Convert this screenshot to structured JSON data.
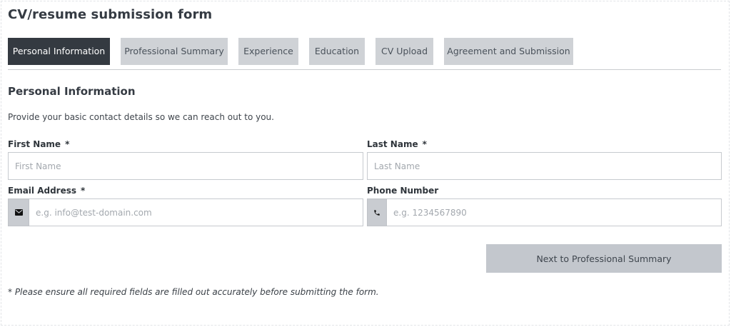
{
  "form": {
    "title": "CV/resume submission form"
  },
  "tabs": [
    {
      "label": "Personal Information",
      "active": true
    },
    {
      "label": "Professional Summary",
      "active": false
    },
    {
      "label": "Experience",
      "active": false
    },
    {
      "label": "Education",
      "active": false
    },
    {
      "label": "CV Upload",
      "active": false
    },
    {
      "label": "Agreement and Submission",
      "active": false
    }
  ],
  "section": {
    "heading": "Personal Information",
    "description": "Provide your basic contact details so we can reach out to you."
  },
  "fields": {
    "first_name": {
      "label": "First Name",
      "required_mark": "*",
      "placeholder": "First Name",
      "value": ""
    },
    "last_name": {
      "label": "Last Name",
      "required_mark": "*",
      "placeholder": "Last Name",
      "value": ""
    },
    "email": {
      "label": "Email Address",
      "required_mark": "*",
      "placeholder": "e.g. info@test-domain.com",
      "value": "",
      "icon": "envelope-icon"
    },
    "phone": {
      "label": "Phone Number",
      "placeholder": "e.g. 1234567890",
      "value": "",
      "icon": "phone-icon"
    }
  },
  "actions": {
    "next_label": "Next to Professional Summary"
  },
  "footnote": "* Please ensure all required fields are filled out accurately before submitting the form.",
  "colors": {
    "active_tab": "#343a41",
    "inactive_tab": "#cfd2d6",
    "button": "#c3c7cd"
  }
}
